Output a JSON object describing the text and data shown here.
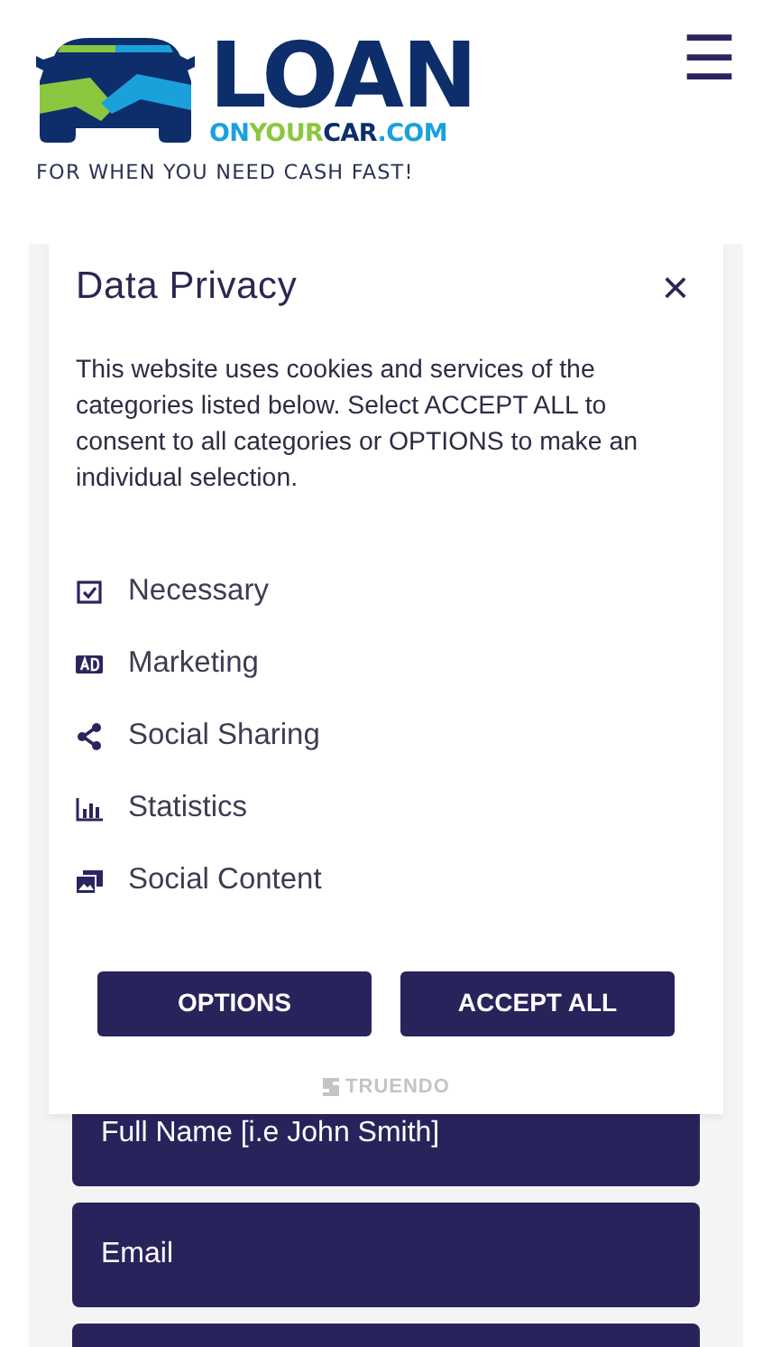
{
  "header": {
    "logo": {
      "word": "LOAN",
      "domain_parts": [
        {
          "text": "ON",
          "color": "#1aa1dc"
        },
        {
          "text": "YOUR",
          "color": "#8cc63f"
        },
        {
          "text": "CAR",
          "color": "#0d2d6b"
        },
        {
          "text": ".COM",
          "color": "#1aa1dc"
        }
      ],
      "tagline": "FOR WHEN YOU NEED CASH FAST!"
    },
    "menu_icon": "☰"
  },
  "dialog": {
    "title": "Data Privacy",
    "close": "×",
    "text": "This website uses cookies and services of the categories listed below. Select ACCEPT ALL to consent to all categories or OPTIONS to make an individual selection.",
    "categories": [
      {
        "kind": "check",
        "label": "Necessary"
      },
      {
        "kind": "ad",
        "label": "Marketing"
      },
      {
        "kind": "share",
        "label": "Social Sharing"
      },
      {
        "kind": "stats",
        "label": "Statistics"
      },
      {
        "kind": "media",
        "label": "Social Content"
      }
    ],
    "buttons": [
      "OPTIONS",
      "ACCEPT ALL"
    ],
    "brand": "TRUENDO"
  },
  "form": {
    "fields": [
      {
        "kind": "text",
        "placeholder": "Full Name [i.e John Smith]"
      },
      {
        "kind": "text",
        "placeholder": "Email"
      },
      {
        "kind": "empty"
      }
    ]
  }
}
